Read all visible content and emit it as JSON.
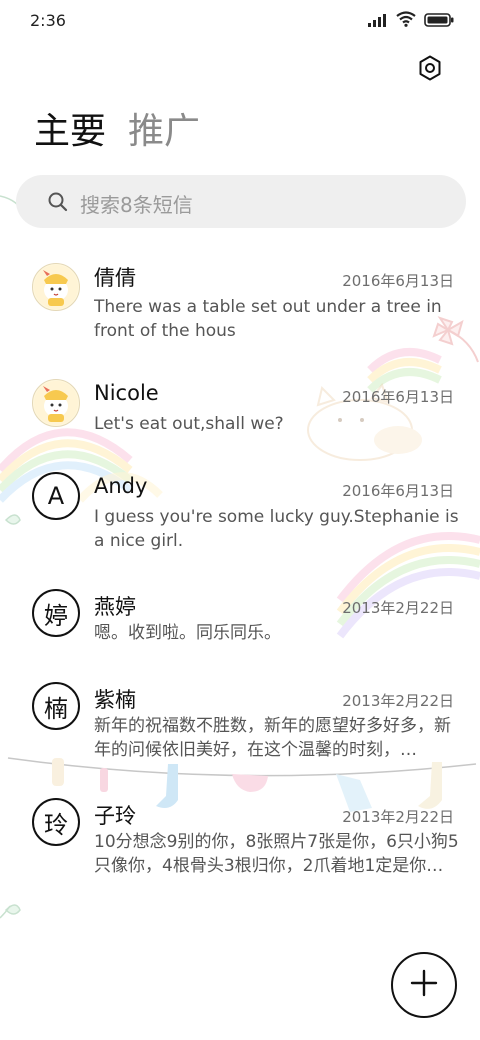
{
  "status_bar": {
    "time": "2:36",
    "icons": [
      "signal-icon",
      "wifi-icon",
      "battery-icon"
    ]
  },
  "header": {
    "settings_icon": "settings-icon",
    "tabs": [
      {
        "label": "主要",
        "active": true
      },
      {
        "label": "推广",
        "active": false
      }
    ]
  },
  "search": {
    "placeholder": "搜索8条短信"
  },
  "conversations": [
    {
      "avatar": "",
      "avatar_type": "photo",
      "name": "倩倩",
      "date": "2016年6月13日",
      "preview": "There was a table set out under a tree in front of the hous"
    },
    {
      "avatar": "",
      "avatar_type": "photo",
      "name": "Nicole",
      "date": "2016年6月13日",
      "preview": "Let's eat out,shall we?"
    },
    {
      "avatar": "A",
      "avatar_type": "letter",
      "name": "Andy",
      "date": "2016年6月13日",
      "preview": "I guess you're some lucky guy.Stephanie is a nice girl."
    },
    {
      "avatar": "婷",
      "avatar_type": "letter",
      "name": "燕婷",
      "date": "2013年2月22日",
      "preview": "嗯。收到啦。同乐同乐。"
    },
    {
      "avatar": "楠",
      "avatar_type": "letter",
      "name": "紫楠",
      "date": "2013年2月22日",
      "preview": "新年的祝福数不胜数，新年的愿望好多好多，新年的问候依旧美好，在这个温馨的时刻，…"
    },
    {
      "avatar": "玲",
      "avatar_type": "letter",
      "name": "子玲",
      "date": "2013年2月22日",
      "preview": "10分想念9别的你，8张照片7张是你，6只小狗5只像你，4根骨头3根归你，2爪着地1定是你…"
    }
  ],
  "fab": {
    "icon": "plus-icon"
  },
  "colors": {
    "text": "#111111",
    "secondary": "#555555",
    "search_bg": "#efefef"
  }
}
